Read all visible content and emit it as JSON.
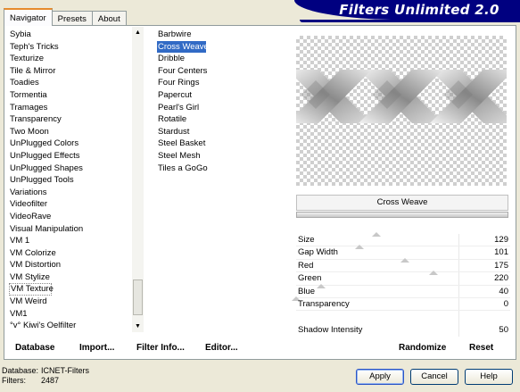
{
  "window": {
    "banner_title": "Filters Unlimited 2.0",
    "tabs": [
      {
        "label": "Navigator",
        "active": true
      },
      {
        "label": "Presets",
        "active": false
      },
      {
        "label": "About",
        "active": false
      }
    ]
  },
  "categories": {
    "items": [
      "Sybia",
      "Teph's Tricks",
      "Texturize",
      "Tile & Mirror",
      "Toadies",
      "Tormentia",
      "Tramages",
      "Transparency",
      "Two Moon",
      "UnPlugged Colors",
      "UnPlugged Effects",
      "UnPlugged Shapes",
      "UnPlugged Tools",
      "Variations",
      "Videofilter",
      "VideoRave",
      "Visual Manipulation",
      "VM 1",
      "VM Colorize",
      "VM Distortion",
      "VM Stylize",
      "VM Texture",
      "VM Weird",
      "VM1",
      "°v° Kiwi's Oelfilter"
    ],
    "selected": "VM Texture"
  },
  "filters": {
    "items": [
      "Barbwire",
      "Cross Weave",
      "Dribble",
      "Four Centers",
      "Four Rings",
      "Papercut",
      "Pearl's Girl",
      "Rotatile",
      "Stardust",
      "Steel Basket",
      "Steel Mesh",
      "Tiles a GoGo"
    ],
    "selected": "Cross Weave"
  },
  "preview": {
    "filter_name": "Cross Weave"
  },
  "controls": [
    {
      "label": "Size",
      "value": "129",
      "level": 129
    },
    {
      "label": "Gap Width",
      "value": "101",
      "level": 101
    },
    {
      "label": "Red",
      "value": "175",
      "level": 175
    },
    {
      "label": "Green",
      "value": "220",
      "level": 220
    },
    {
      "label": "Blue",
      "value": "40",
      "level": 40
    },
    {
      "label": "Transparency",
      "value": "0",
      "level": 0
    }
  ],
  "shadow_intensity": {
    "label": "Shadow Intensity",
    "value": "50"
  },
  "commands": {
    "database": "Database",
    "import": "Import...",
    "filter_info": "Filter Info...",
    "editor": "Editor...",
    "randomize": "Randomize",
    "reset": "Reset"
  },
  "status": {
    "database_key": "Database:",
    "database_value": "ICNET-Filters",
    "filters_key": "Filters:",
    "filters_value": "2487"
  },
  "buttons": {
    "apply": "Apply",
    "cancel": "Cancel",
    "help": "Help"
  },
  "colors": {
    "banner": "#000080",
    "selection": "#316ac5"
  }
}
